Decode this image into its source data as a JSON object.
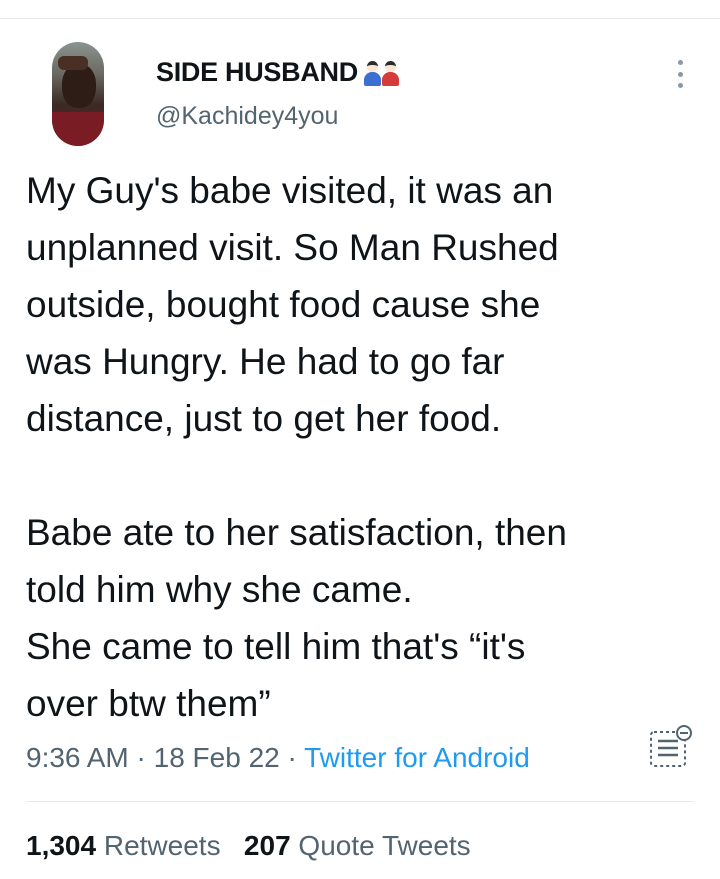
{
  "author": {
    "display_name": "SIDE HUSBAND",
    "display_name_emoji": "couple-dolls-emoji",
    "handle": "@Kachidey4you"
  },
  "tweet": {
    "paragraphs": [
      [
        "My Guy's babe visited, it was an",
        "unplanned visit. So Man Rushed",
        "outside, bought food cause she",
        "was Hungry. He had to go far",
        "distance, just to get her food."
      ],
      [
        "Babe ate to her satisfaction, then",
        "told him why she came.",
        "She came to tell him that's “it's",
        "over btw them”"
      ]
    ]
  },
  "meta": {
    "time": "9:36 AM",
    "date": "18 Feb 22",
    "separator": " · ",
    "source": "Twitter for Android"
  },
  "stats": {
    "retweets_count": "1,304",
    "retweets_label": "Retweets",
    "quotes_count": "207",
    "quotes_label": "Quote Tweets"
  },
  "icons": {
    "more": "more-vertical-icon",
    "analytics": "analytics-icon"
  },
  "colors": {
    "text": "#0f1419",
    "secondary": "#536471",
    "link": "#1d9bf0",
    "divider": "#e6e9ec"
  }
}
